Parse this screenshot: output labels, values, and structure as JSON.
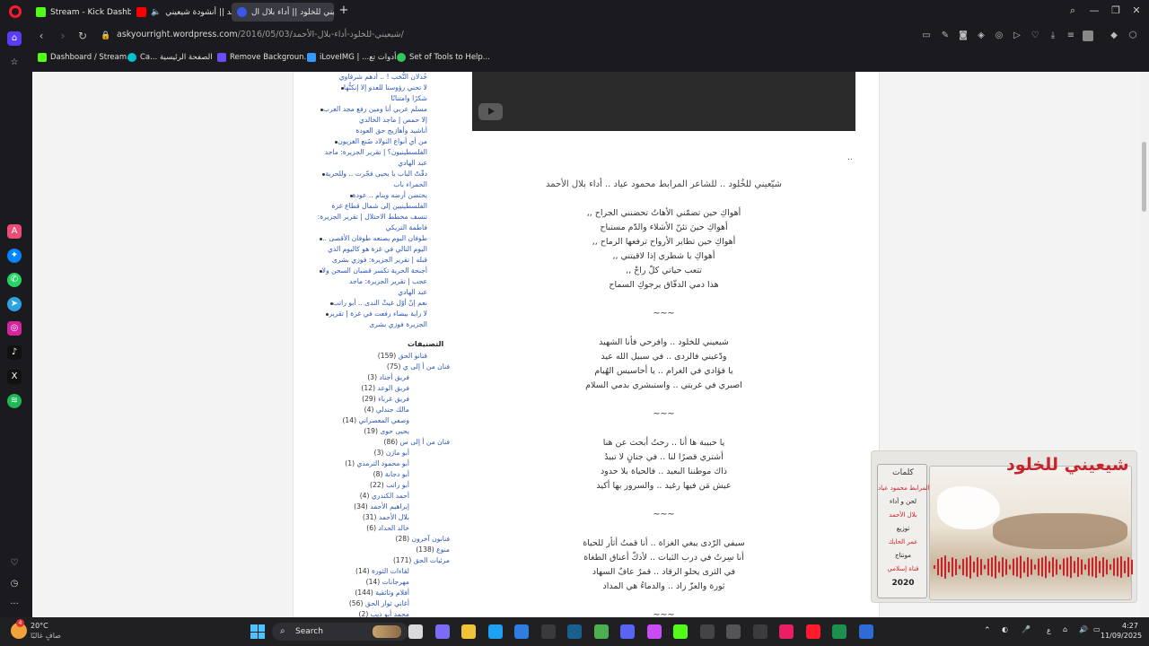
{
  "tabs": [
    {
      "label": "Stream - Kick Dashboard",
      "color": "#53fc18"
    },
    {
      "label": "جديد || أنشودة شيعيني",
      "color": "#ff0000"
    },
    {
      "label": "شيعيني للخلود || أداء بلال ال",
      "color": "#3858e9"
    }
  ],
  "address": {
    "host": "askyourright.wordpress.com",
    "path": "/2016/05/03/شيعيني-للخلود-أداء-بلال-الأحمد/"
  },
  "bookmarks": [
    {
      "label": "Dashboard / Stream...",
      "color": "#53fc18"
    },
    {
      "label": "Ca... الصفحة الرئيسية",
      "color": "#00c4cc"
    },
    {
      "label": "Remove Backgroun...",
      "color": "#6b4cf6"
    },
    {
      "label": "iLoveIMG | ...أدوات تع",
      "color": "#3399ff"
    },
    {
      "label": "Set of Tools to Help...",
      "color": "#34c759"
    }
  ],
  "recent_posts": [
    "خُذلان النُّخب ! .. أدهم شرقاوي",
    "لا تحني رؤوسنا للعدو إلا إنكنُّها",
    "شكرًا وامتنانًا",
    "مسلم عربي أنا ومين رفع مجد العرب",
    "إلا حمص | ماجد الخالدي",
    "أناشيد وأهازيج حق العودة",
    "من أي أنواع النولاد صُنع الغزيون",
    "الفلسطينيون؟ | تقرير الجزيرة: ماجد",
    "عبد الهادي",
    "دقّتْ الباب يا يحيى فجّرت .. وللحرية",
    "الحمراء باب",
    "يحتضن أرضه وينام .. عودة",
    "الفلسطينيين إلى شمال قطاع غزة",
    "تنسف مخطط الاحتلال | تقرير الجزيرة:",
    "فاطمة التريكي",
    "طوفان اليوم يصنعه طوفان الأقصى ..",
    "اليوم التالي في غزة هو كاليوم الذي",
    "قبله | تقرير الجزيرة: فوزي بشرى",
    "أجنحة الحرية تكسر قضبان السجن ولا",
    "عجب | تقرير الجزيرة: ماجد",
    "عبد الهادي",
    "نعم إنّ أوّل غيثْ الندى .. أبو راتب",
    "لا راية بيضاء رفعت في غزة | تقرير",
    "الجزيرة فوزي بشرى"
  ],
  "categories_heading": "التصنيفات",
  "categories": [
    {
      "name": "قنانو الحق",
      "count": "(159)",
      "level": 0
    },
    {
      "name": "فنان من أ إلى ي",
      "count": "(75)",
      "level": 1
    },
    {
      "name": "فريق أجناد",
      "count": "(3)",
      "level": 2
    },
    {
      "name": "فريق الوعد",
      "count": "(12)",
      "level": 2
    },
    {
      "name": "فريق غرباء",
      "count": "(29)",
      "level": 2
    },
    {
      "name": "مالك جندلي",
      "count": "(4)",
      "level": 2
    },
    {
      "name": "وصفي المعصراني",
      "count": "(14)",
      "level": 2
    },
    {
      "name": "يحيى حوى",
      "count": "(19)",
      "level": 2
    },
    {
      "name": "فنان من أ إلى س",
      "count": "(86)",
      "level": 1
    },
    {
      "name": "أبو مازن",
      "count": "(3)",
      "level": 2
    },
    {
      "name": "أبو محمود الترمذي",
      "count": "(1)",
      "level": 2
    },
    {
      "name": "أبو دجانة",
      "count": "(8)",
      "level": 2
    },
    {
      "name": "أبو راتب",
      "count": "(22)",
      "level": 2
    },
    {
      "name": "أحمد الكندري",
      "count": "(4)",
      "level": 2
    },
    {
      "name": "إبراهيم الأحمد",
      "count": "(34)",
      "level": 2
    },
    {
      "name": "بلال الأحمد",
      "count": "(31)",
      "level": 2
    },
    {
      "name": "خالد الحداد",
      "count": "(6)",
      "level": 2
    },
    {
      "name": "فنانون آخرون",
      "count": "(28)",
      "level": 1
    },
    {
      "name": "منوع",
      "count": "(138)",
      "level": 1
    },
    {
      "name": "مرئيات الحق",
      "count": "(171)",
      "level": 1
    },
    {
      "name": "لقاءات الثورة",
      "count": "(14)",
      "level": 2
    },
    {
      "name": "مهرجانات",
      "count": "(14)",
      "level": 2
    },
    {
      "name": "أفلام وثائقية",
      "count": "(144)",
      "level": 2
    },
    {
      "name": "أغاني ثوار الحق",
      "count": "(56)",
      "level": 2
    },
    {
      "name": "محمد أبو ذيب",
      "count": "(2)",
      "level": 2
    }
  ],
  "post": {
    "dots": "..",
    "title": "شيّعيني للخُلود .. للشاعر المرابط محمود عياد .. أداء بلال الأحمد",
    "stanzas": [
      [
        "أهواكِ حين تضمّني الأهاتُ تحضنني الجراح ,,",
        "أهواكِ حينَ تئنّ الأشلاء والدّم مستباح",
        "أهواكِ حين تطاير الأرواح ترفعها الرماح ,,",
        "أهواكِ يا شطري إذا لاقيتني ,,",
        "تتعب حياتي كلّ راحْ ,,",
        "هذا دمي الدفّاق يرجوكِ السماح"
      ],
      [
        "شيعيني للخلود .. وافرحي فأنا الشهيد",
        "ودّعيني فالردى .. في سبيل الله عيد",
        "يا فؤادي في الغرام .. يا أحاسيس الهُيام",
        "اصبري في غربتي .. واستبشري بدمي السلام"
      ],
      [
        "يا حبيبة ها أنا .. رحتُ أبحث عن هنا",
        "أشتري قصرًا لنا .. في جنانٍ لا تبيدُ",
        "ذاك موطننا البعيد .. فالحياة بلا حدود",
        "عيش مَن فيها رغيد .. والسرور بها أكيد"
      ],
      [
        "سيفي الرّدى يبغي الغزاة .. أنا قمتُ أثأر للحياة",
        "أنا سِرتُ في درب الثبات .. لأذكّ أعناق الطغاة",
        "في الثرى يحلو الرقاد .. قمرٌ عافٌ السهاد",
        "ثورة والعزّ زاد .. والدماءُ هي المداد"
      ]
    ],
    "separator": "~~~"
  },
  "promo": {
    "title": "شيعيني للخلود",
    "credits_heading": "كلمات",
    "lines": [
      "المرابط محمود عياد",
      "لحن و أداء",
      "بلال الأحمد",
      "توزيع",
      "عمر الحايك",
      "مونتاج",
      "قناة إسلامي",
      "2020"
    ]
  },
  "taskbar": {
    "weather_temp": "20°C",
    "weather_desc": "صافٍ غالبًا",
    "weather_badge": "4",
    "search": "Search",
    "time": "4:27",
    "date": "11/09/2025",
    "lang": "ع"
  }
}
